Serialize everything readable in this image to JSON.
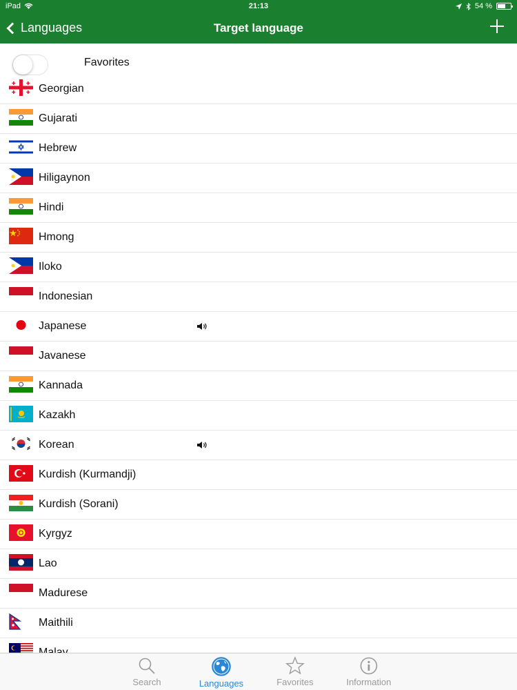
{
  "status_bar": {
    "device": "iPad",
    "time": "21:13",
    "battery": "54 %"
  },
  "navbar": {
    "back_label": "Languages",
    "title": "Target language"
  },
  "favorites": {
    "label": "Favorites",
    "enabled": false
  },
  "languages": [
    {
      "name": "Georgian",
      "audio": false
    },
    {
      "name": "Gujarati",
      "audio": false
    },
    {
      "name": "Hebrew",
      "audio": false
    },
    {
      "name": "Hiligaynon",
      "audio": false
    },
    {
      "name": "Hindi",
      "audio": false
    },
    {
      "name": "Hmong",
      "audio": false
    },
    {
      "name": "Iloko",
      "audio": false
    },
    {
      "name": "Indonesian",
      "audio": false
    },
    {
      "name": "Japanese",
      "audio": true
    },
    {
      "name": "Javanese",
      "audio": false
    },
    {
      "name": "Kannada",
      "audio": false
    },
    {
      "name": "Kazakh",
      "audio": false
    },
    {
      "name": "Korean",
      "audio": true
    },
    {
      "name": "Kurdish (Kurmandji)",
      "audio": false
    },
    {
      "name": "Kurdish (Sorani)",
      "audio": false
    },
    {
      "name": "Kyrgyz",
      "audio": false
    },
    {
      "name": "Lao",
      "audio": false
    },
    {
      "name": "Madurese",
      "audio": false
    },
    {
      "name": "Maithili",
      "audio": false
    },
    {
      "name": "Malay",
      "audio": false
    }
  ],
  "tabs": [
    {
      "label": "Search",
      "icon": "search-icon",
      "active": false
    },
    {
      "label": "Languages",
      "icon": "globe-icon",
      "active": true
    },
    {
      "label": "Favorites",
      "icon": "star-icon",
      "active": false
    },
    {
      "label": "Information",
      "icon": "info-icon",
      "active": false
    }
  ],
  "colors": {
    "header": "#1a7f2e",
    "tab_active": "#2a86d6",
    "tab_inactive": "#9a9a9a"
  }
}
